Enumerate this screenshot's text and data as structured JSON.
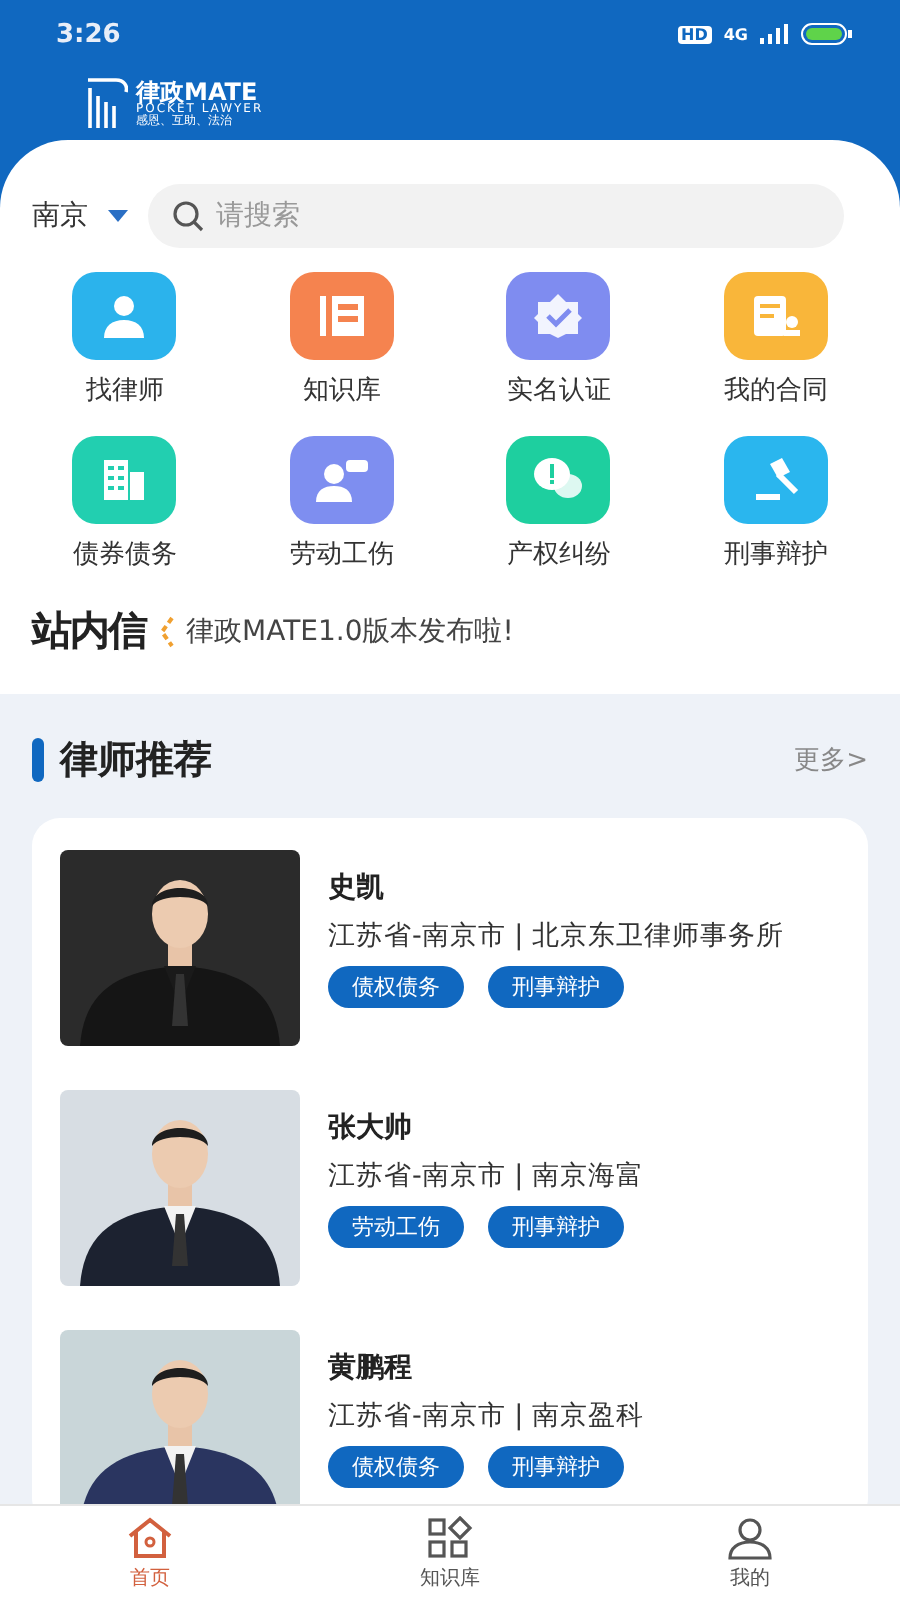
{
  "status_bar": {
    "time": "3:26",
    "hd": "HD",
    "network": "4G"
  },
  "logo": {
    "name": "律政MATE",
    "subtitle": "POCKET LAWYER",
    "slogan": "感恩、互助、法治"
  },
  "location": {
    "city": "南京"
  },
  "search": {
    "placeholder": "请搜索"
  },
  "services": [
    {
      "label": "找律师",
      "kind": "lawyer",
      "color": "#2bb3ec"
    },
    {
      "label": "知识库",
      "kind": "book",
      "color": "#f5834f"
    },
    {
      "label": "实名认证",
      "kind": "badge",
      "color": "#7f8cf0"
    },
    {
      "label": "我的合同",
      "kind": "contract",
      "color": "#f9b63a"
    },
    {
      "label": "债券债务",
      "kind": "building",
      "color": "#22cfb0"
    },
    {
      "label": "劳动工伤",
      "kind": "worker",
      "color": "#7e8ef0"
    },
    {
      "label": "产权纠纷",
      "kind": "dispute",
      "color": "#1ecf9f"
    },
    {
      "label": "刑事辩护",
      "kind": "gavel",
      "color": "#2ab6ee"
    }
  ],
  "notice": {
    "title": "站内信",
    "message": "律政MATE1.0版本发布啦!"
  },
  "recommend": {
    "title": "律师推荐",
    "more": "更多>",
    "lawyers": [
      {
        "name": "史凯",
        "location": "江苏省-南京市 | 北京东卫律师事务所",
        "tags": [
          "债权债务",
          "刑事辩护"
        ],
        "photo": {
          "kind": "picture"
        }
      },
      {
        "name": "张大帅",
        "location": "江苏省-南京市 | 南京海富",
        "tags": [
          "劳动工伤",
          "刑事辩护"
        ],
        "photo": {
          "kind": "picture"
        }
      },
      {
        "name": "黄鹏程",
        "location": "江苏省-南京市 | 南京盈科",
        "tags": [
          "债权债务",
          "刑事辩护"
        ],
        "photo": {
          "kind": "picture"
        }
      }
    ]
  },
  "tab_bar": [
    {
      "label": "首页",
      "kind": "home",
      "selected": true
    },
    {
      "label": "知识库",
      "kind": "grid",
      "selected": false
    },
    {
      "label": "我的",
      "kind": "user",
      "selected": false
    }
  ]
}
